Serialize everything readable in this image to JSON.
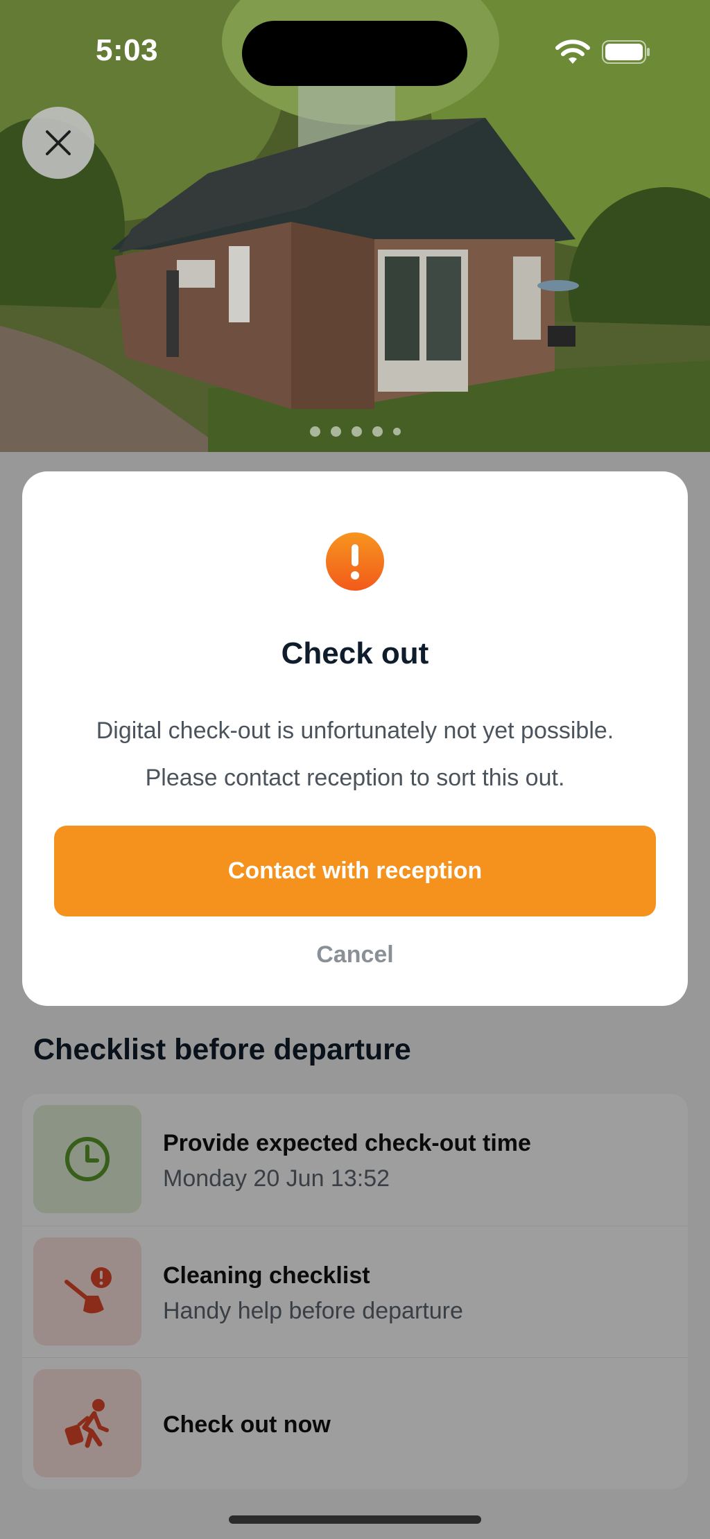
{
  "status_bar": {
    "time": "5:03"
  },
  "hero": {
    "close_icon": "close-icon",
    "carousel_dots": 5,
    "carousel_active_index": 0
  },
  "modal": {
    "icon": "exclamation-icon",
    "icon_color": "#f26b1d",
    "title": "Check out",
    "body_line1": "Digital check-out is unfortunately not yet possible.",
    "body_line2": "Please contact reception to sort this out.",
    "primary_label": "Contact with reception",
    "primary_color": "#f5921e",
    "cancel_label": "Cancel"
  },
  "checklist": {
    "title": "Checklist before departure",
    "items": [
      {
        "icon": "clock-icon",
        "title": "Provide expected check-out time",
        "subtitle": "Monday 20 Jun 13:52",
        "accent": "#5a9a2a"
      },
      {
        "icon": "broom-alert-icon",
        "title": "Cleaning checklist",
        "subtitle": "Handy help before departure",
        "accent": "#e0482a"
      },
      {
        "icon": "person-luggage-icon",
        "title": "Check out now",
        "subtitle": "",
        "accent": "#e0482a"
      }
    ]
  }
}
